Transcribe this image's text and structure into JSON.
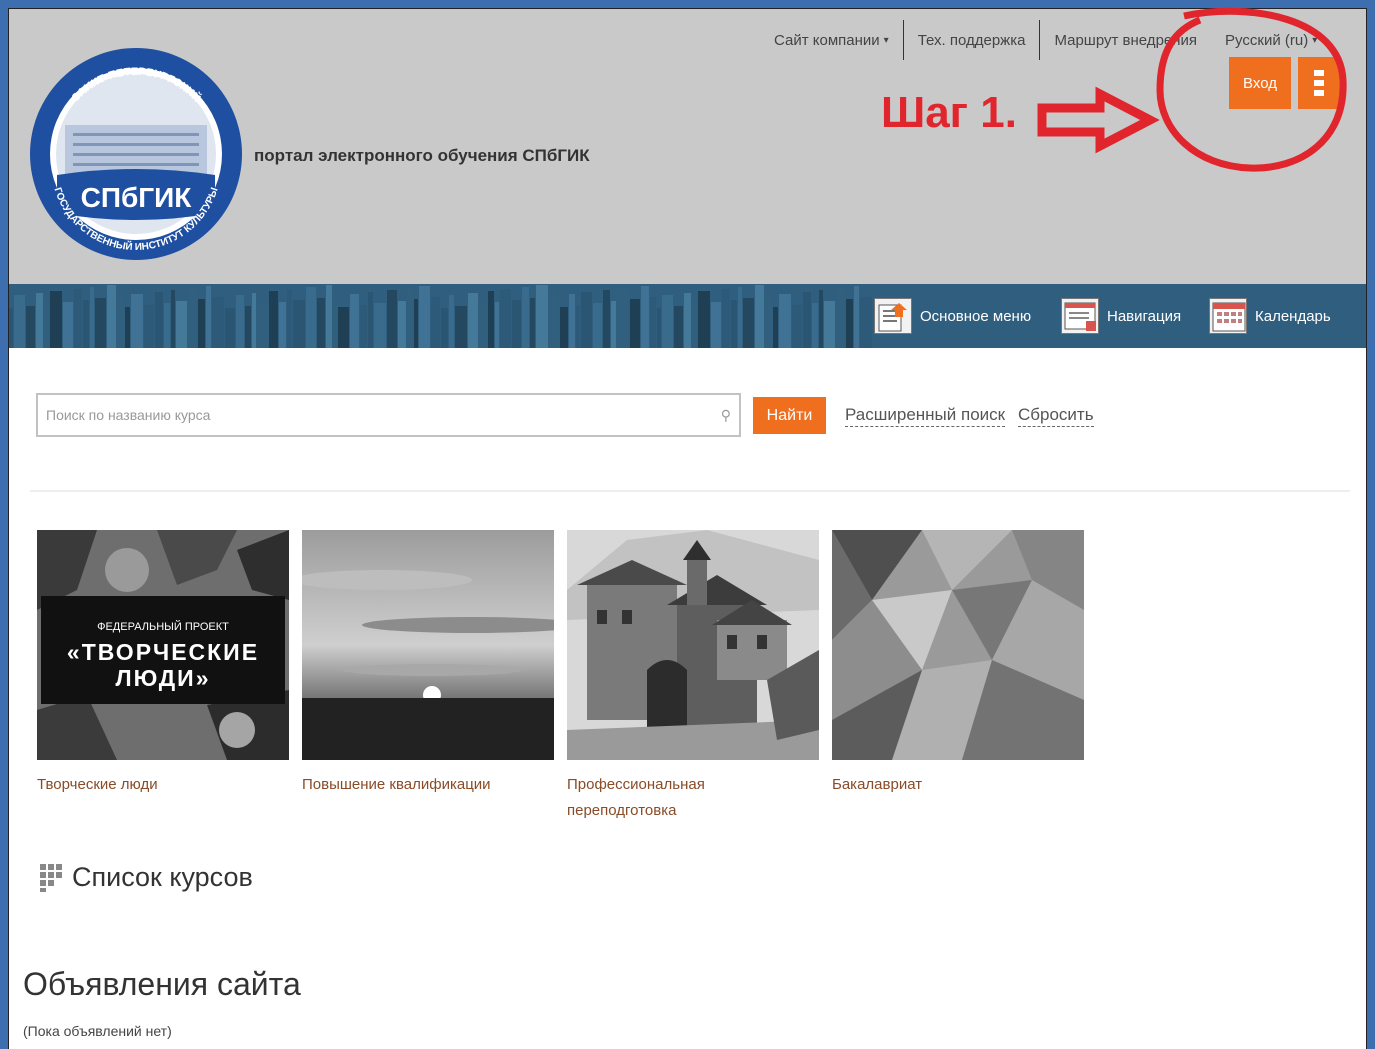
{
  "header": {
    "portal_title": "портал электронного обучения СПбГИК",
    "logo": {
      "top_text": "САНКТ-ПЕТЕРБУРГСКИЙ",
      "bottom_text": "ГОСУДАРСТВЕННЫЙ ИНСТИТУТ КУЛЬТУРЫ",
      "center_text": "СПбГИК"
    },
    "topnav": {
      "company_site": "Сайт компании",
      "support": "Тех. поддержка",
      "route": "Маршрут внедрения",
      "language": "Русский (ru)"
    },
    "login_label": "Вход"
  },
  "annotation": {
    "step_label": "Шаг 1.",
    "color": "#e1252d"
  },
  "banner": {
    "main_menu": "Основное меню",
    "navigation": "Навигация",
    "calendar": "Календарь"
  },
  "search": {
    "placeholder": "Поиск по названию курса",
    "find_label": "Найти",
    "advanced_label": "Расширенный поиск",
    "reset_label": "Сбросить"
  },
  "categories": [
    {
      "label": "Творческие люди",
      "poster_small": "ФЕДЕРАЛЬНЫЙ ПРОЕКТ",
      "poster_big_1": "«ТВОРЧЕСКИЕ",
      "poster_big_2": "ЛЮДИ»"
    },
    {
      "label": "Повышение квалификации"
    },
    {
      "label": "Профессиональная переподготовка"
    },
    {
      "label": "Бакалавриат"
    }
  ],
  "courses_title": "Список курсов",
  "news": {
    "title": "Объявления сайта",
    "empty": "(Пока объявлений нет)"
  },
  "colors": {
    "accent": "#f06f1e",
    "frame": "#3d6fb0",
    "header_bg": "#c9c9c9",
    "banner_bg": "#2f5e7e",
    "category_link": "#8a4b27"
  }
}
